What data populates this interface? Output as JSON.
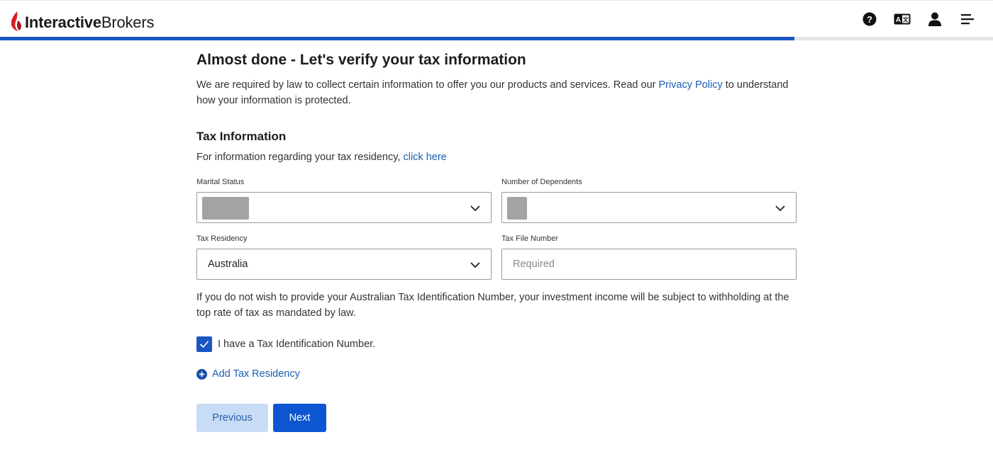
{
  "header": {
    "logo_text_bold": "Interactive",
    "logo_text_regular": "Brokers",
    "icons": [
      "help-icon",
      "language-icon",
      "user-icon",
      "menu-icon"
    ]
  },
  "progress": {
    "fraction": 0.8
  },
  "page": {
    "title": "Almost done - Let's verify your tax information",
    "intro_before_link": "We are required by law to collect certain information to offer you our products and services. Read our ",
    "intro_link": "Privacy Policy",
    "intro_after_link": " to understand how your information is protected."
  },
  "tax": {
    "section_title": "Tax Information",
    "residency_info_text": "For information regarding your tax residency, ",
    "residency_info_link": "click here",
    "marital_status_label": "Marital Status",
    "dependents_label": "Number of Dependents",
    "residency_label": "Tax Residency",
    "residency_value": "Australia",
    "tfn_label": "Tax File Number",
    "tfn_placeholder": "Required",
    "warning": "If you do not wish to provide your Australian Tax Identification Number, your investment income will be subject to withholding at the top rate of tax as mandated by law.",
    "checkbox_label": "I have a Tax Identification Number.",
    "add_residency": "Add Tax Residency"
  },
  "buttons": {
    "previous": "Previous",
    "next": "Next"
  },
  "colors": {
    "primary": "#0d56d1",
    "link": "#1a5fb4",
    "secondary_bg": "#c9dcf5",
    "logo_red": "#d81f26"
  }
}
